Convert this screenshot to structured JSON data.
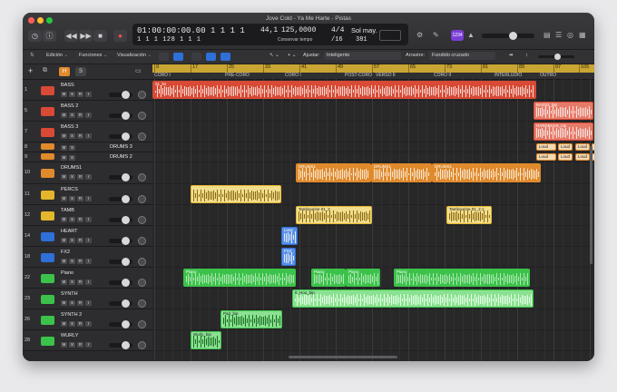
{
  "window": {
    "title": "Jove Cold - Ya Me Harte - Pistas"
  },
  "lcd": {
    "position": "01:00:00:00.00",
    "bars": "1  1  1    1",
    "bars2": "1  1  1    128  1  1    1",
    "tempo": "125,0000",
    "tempo_label": "Conservar tempo",
    "sample_rate": "44,1",
    "signature": "4/4",
    "division": "/16",
    "key": "Sol may.",
    "cpu": "381",
    "badge": "1234"
  },
  "toolbar": {
    "edit": "Edición",
    "functions": "Funciones",
    "view": "Visualización",
    "snap_label": "Ajustar:",
    "snap_value": "Inteligente",
    "drag_label": "Arrastre:",
    "drag_value": "Fundido cruzado"
  },
  "trackheader": {
    "plus": "+",
    "h": "H",
    "s": "S"
  },
  "ruler": {
    "numbers": [
      "9",
      "17",
      "25",
      "33",
      "41",
      "49",
      "57",
      "65",
      "73",
      "81",
      "89",
      "97",
      "105",
      "113"
    ]
  },
  "markers": [
    "CORO I",
    "PRE-CORO",
    "CORO I",
    "POST-CORO",
    "VERSO II",
    "CORO II",
    "INTERLUDIO",
    "OUTRO"
  ],
  "tracks": [
    {
      "num": "1",
      "name": "BASS",
      "color": "#d84a35",
      "h": 23
    },
    {
      "num": "5",
      "name": "BASS 2",
      "color": "#d84a35",
      "h": 23
    },
    {
      "num": "7",
      "name": "BASS 3",
      "color": "#d84a35",
      "h": 23
    },
    {
      "num": "8",
      "name": "DRUMS 3",
      "color": "#e08a2c",
      "h": 11
    },
    {
      "num": "9",
      "name": "DRUMS 2",
      "color": "#e08a2c",
      "h": 11
    },
    {
      "num": "10",
      "name": "DRUMS1",
      "color": "#e08a2c",
      "h": 24
    },
    {
      "num": "11",
      "name": "PERCS",
      "color": "#e3b62c",
      "h": 23
    },
    {
      "num": "12",
      "name": "TAMB",
      "color": "#e3b62c",
      "h": 23
    },
    {
      "num": "14",
      "name": "HEART",
      "color": "#2f6fd8",
      "h": 23
    },
    {
      "num": "18",
      "name": "FX2",
      "color": "#2f6fd8",
      "h": 23
    },
    {
      "num": "22",
      "name": "Piano",
      "color": "#3cc24a",
      "h": 23
    },
    {
      "num": "23",
      "name": "SYNTH",
      "color": "#3cc24a",
      "h": 23
    },
    {
      "num": "26",
      "name": "SYNTH 2",
      "color": "#3cc24a",
      "h": 23
    },
    {
      "num": "28",
      "name": "WURLY",
      "color": "#3cc24a",
      "h": 23
    }
  ],
  "regions": {
    "bass": "01_bs",
    "bass2": "BASS2_bip",
    "bass3": "HARDBASS_bip",
    "loud": "Loud",
    "drums1": "DRUMS1",
    "tamb": "Tambourine 01_2",
    "tamb2": "Tambourine 01_2.1",
    "heart": "Love",
    "fx": "FX2",
    "piano": "Piano",
    "synth": "5_Hoo_bip",
    "pad": "Pad_bip",
    "wurly": "Wurly_bip"
  },
  "colors": {
    "bass": "#d84a35",
    "drums": "#e08a2c",
    "percs": "#e3b62c",
    "blue": "#2f6fd8",
    "green": "#3cc24a",
    "ruler": "#c9a534"
  }
}
